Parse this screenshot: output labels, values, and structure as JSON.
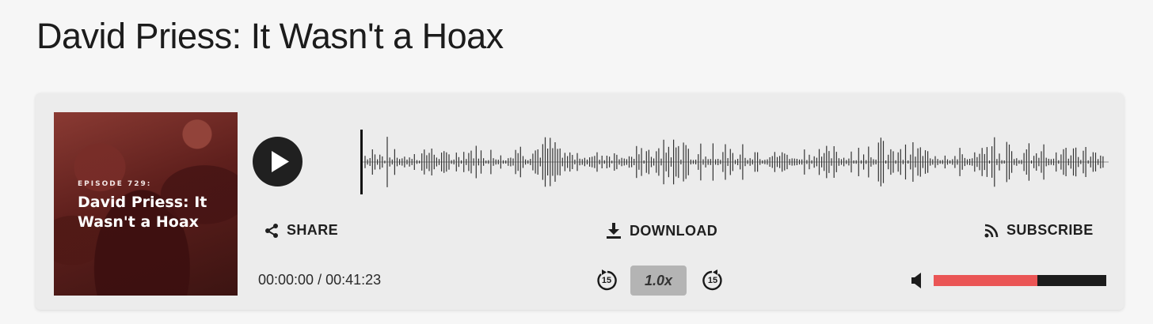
{
  "page": {
    "title": "David Priess: It Wasn't a Hoax"
  },
  "player": {
    "cover": {
      "episode_label": "EPISODE 729:",
      "title": "David Priess: It Wasn't a Hoax"
    },
    "play_icon": "play-icon",
    "actions": {
      "share_label": "SHARE",
      "download_label": "DOWNLOAD",
      "subscribe_label": "SUBSCRIBE"
    },
    "time": {
      "current": "00:00:00",
      "separator": "/",
      "duration": "00:41:23",
      "display": "00:00:00 / 00:41:23"
    },
    "skip_back_seconds": "15",
    "skip_forward_seconds": "15",
    "speed": "1.0x",
    "volume_level": 0.6,
    "playback_progress": 0.0,
    "colors": {
      "volume_fill": "#ea5555",
      "volume_track": "#1c1c1c",
      "waveform": "#333333",
      "play_button": "#202020",
      "speed_button": "#b4b4b4"
    }
  }
}
